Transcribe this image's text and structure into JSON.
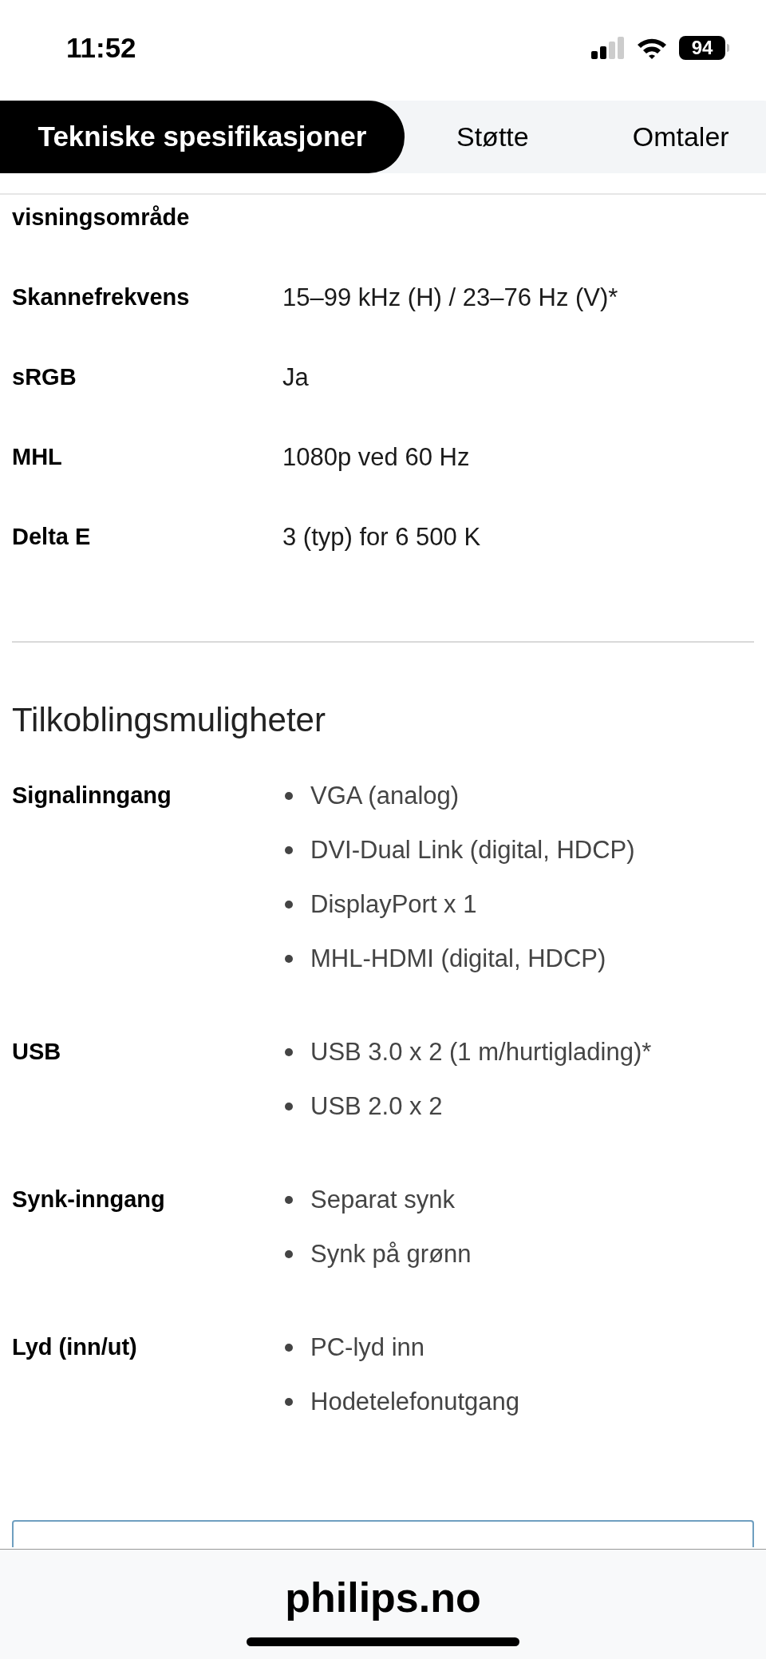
{
  "status_bar": {
    "time": "11:52",
    "battery": "94"
  },
  "tabs": [
    {
      "label": "Tekniske spesifikasjoner",
      "selected": true
    },
    {
      "label": "Støtte",
      "selected": false
    },
    {
      "label": "Omtaler",
      "selected": false
    }
  ],
  "sections": [
    {
      "rows": [
        {
          "kind": "label_only",
          "label": "visningsområde"
        },
        {
          "kind": "text",
          "label": "Skannefrekvens",
          "value": "15–99 kHz (H) / 23–76 Hz (V)*"
        },
        {
          "kind": "text",
          "label": "sRGB",
          "value": "Ja"
        },
        {
          "kind": "text",
          "label": "MHL",
          "value": "1080p ved 60 Hz"
        },
        {
          "kind": "text",
          "label": "Delta E",
          "value": "3 (typ) for 6 500 K"
        }
      ]
    },
    {
      "heading": "Tilkoblingsmuligheter",
      "rows": [
        {
          "kind": "list",
          "label": "Signalinngang",
          "items": [
            "VGA (analog)",
            "DVI-Dual Link (digital, HDCP)",
            "DisplayPort x 1",
            "MHL-HDMI (digital, HDCP)"
          ]
        },
        {
          "kind": "list",
          "label": "USB",
          "items": [
            "USB 3.0 x 2 (1 m/hurtiglading)*",
            "USB 2.0 x 2"
          ]
        },
        {
          "kind": "list",
          "label": "Synk-inngang",
          "items": [
            "Separat synk",
            "Synk på grønn"
          ]
        },
        {
          "kind": "list",
          "label": "Lyd (inn/ut)",
          "items": [
            "PC-lyd inn",
            "Hodetelefonutgang"
          ]
        }
      ]
    }
  ],
  "address_bar": {
    "url": "philips.no"
  }
}
